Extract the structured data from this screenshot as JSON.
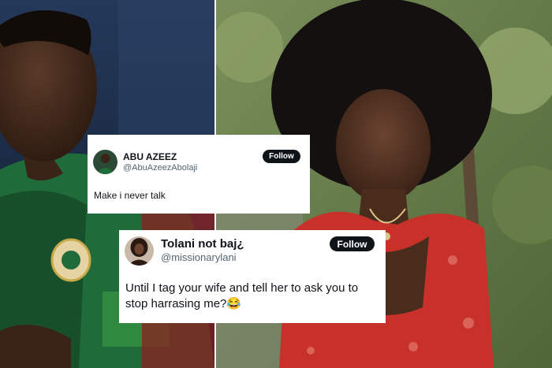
{
  "tweets": [
    {
      "name": "ABU AZEEZ",
      "handle": "@AbuAzeezAbolaji",
      "follow_label": "Follow",
      "text": "Make i never talk",
      "avatar_icon": "user-avatar-icon"
    },
    {
      "name": "Tolani not baj¿",
      "handle": "@missionarylani",
      "follow_label": "Follow",
      "text": "Until I tag your wife and tell her to ask you to stop harrasing me?😂",
      "avatar_icon": "user-avatar-icon"
    }
  ],
  "colors": {
    "jersey_green": "#1f6b3a",
    "dress_red": "#c8312a",
    "follow_button": "#0f1419",
    "handle_gray": "#536471"
  }
}
